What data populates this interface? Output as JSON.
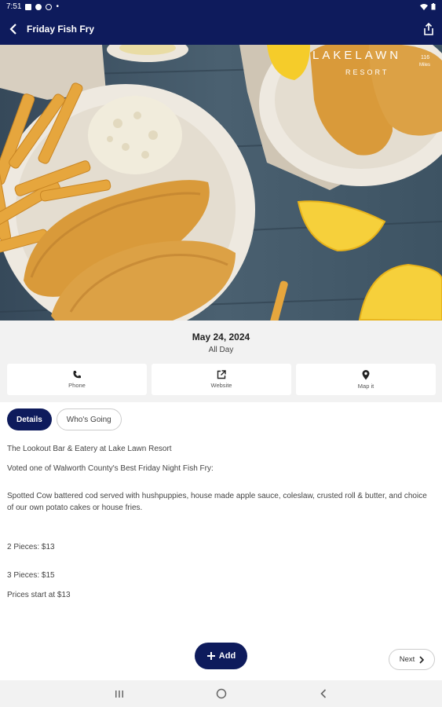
{
  "status_bar": {
    "time": "7:51",
    "dot": "•"
  },
  "app_bar": {
    "title": "Friday Fish Fry"
  },
  "hero": {
    "logo_line1": "LAKELAWN",
    "logo_line2": "RESORT",
    "miles_value": "116",
    "miles_label": "Miles"
  },
  "event": {
    "date": "May 24, 2024",
    "time": "All Day"
  },
  "actions": [
    {
      "label": "Phone",
      "icon": "phone-icon"
    },
    {
      "label": "Website",
      "icon": "external-link-icon"
    },
    {
      "label": "Map it",
      "icon": "map-pin-icon"
    }
  ],
  "tabs": [
    {
      "label": "Details",
      "active": true
    },
    {
      "label": "Who's Going",
      "active": false
    }
  ],
  "details": {
    "venue": "The Lookout Bar & Eatery at Lake Lawn Resort",
    "voted": "Voted one of Walworth County's Best Friday Night Fish Fry:",
    "description": "Spotted Cow battered cod served with hushpuppies, house made apple sauce, coleslaw, crusted roll & butter, and choice of our own potato cakes or house fries.",
    "price_2": "2 Pieces: $13",
    "price_3": "3 Pieces: $15",
    "prices_start": "Prices start at $13"
  },
  "buttons": {
    "add": "Add",
    "next": "Next"
  },
  "colors": {
    "primary": "#0e1b5c",
    "background_gray": "#f2f2f2"
  }
}
